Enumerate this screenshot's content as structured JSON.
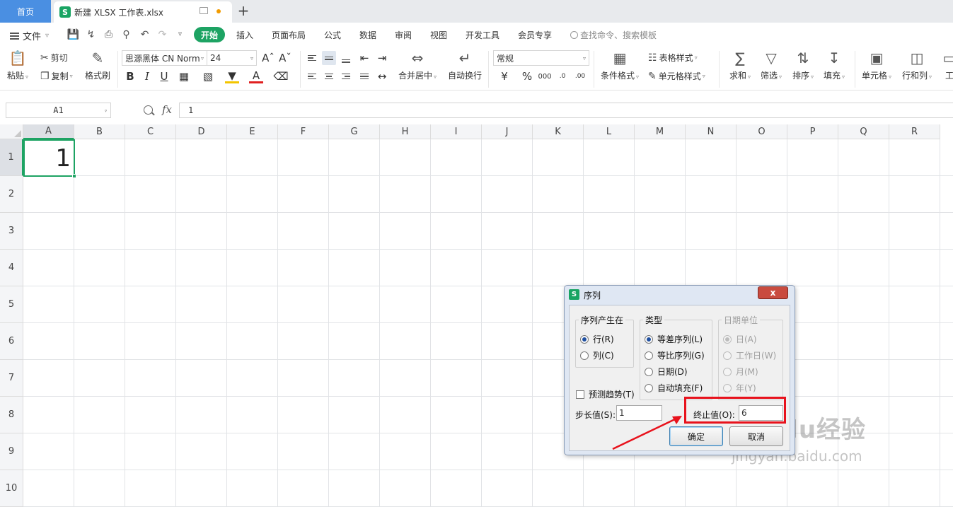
{
  "tabs": {
    "home": "首页",
    "doc_icon": "S",
    "doc_title": "新建 XLSX 工作表.xlsx",
    "add": "+"
  },
  "menu": {
    "file": "文件",
    "items": [
      "开始",
      "插入",
      "页面布局",
      "公式",
      "数据",
      "审阅",
      "视图",
      "开发工具",
      "会员专享"
    ],
    "search_placeholder": "查找命令、搜索模板"
  },
  "ribbon": {
    "paste": "粘贴",
    "cut": "剪切",
    "copy": "复制",
    "format_painter": "格式刷",
    "font_name": "思源黑体 CN Norm",
    "font_size": "24",
    "merge_center": "合并居中",
    "wrap_text": "自动换行",
    "number_format": "常规",
    "cond_format": "条件格式",
    "table_style": "表格样式",
    "cell_style": "单元格样式",
    "sum": "求和",
    "filter": "筛选",
    "sort": "排序",
    "fill": "填充",
    "cell": "单元格",
    "row_col": "行和列",
    "work": "工"
  },
  "formula_bar": {
    "name_box": "A1",
    "fx": "fx",
    "value": "1"
  },
  "sheet": {
    "columns": [
      "A",
      "B",
      "C",
      "D",
      "E",
      "F",
      "G",
      "H",
      "I",
      "J",
      "K",
      "L",
      "M",
      "N",
      "O",
      "P",
      "Q",
      "R"
    ],
    "rows": [
      "1",
      "2",
      "3",
      "4",
      "5",
      "6",
      "7",
      "8",
      "9",
      "10"
    ],
    "active_cell_value": "1"
  },
  "dialog": {
    "icon": "S",
    "title": "序列",
    "close": "x",
    "group_series_in": "序列产生在",
    "opt_rows": "行(R)",
    "opt_cols": "列(C)",
    "group_type": "类型",
    "opt_linear": "等差序列(L)",
    "opt_growth": "等比序列(G)",
    "opt_date": "日期(D)",
    "opt_autofill": "自动填充(F)",
    "group_date_unit": "日期单位",
    "opt_day": "日(A)",
    "opt_weekday": "工作日(W)",
    "opt_month": "月(M)",
    "opt_year": "年(Y)",
    "trend": "预测趋势(T)",
    "step_label": "步长值(S):",
    "step_value": "1",
    "stop_label": "终止值(O):",
    "stop_value": "6",
    "ok": "确定",
    "cancel": "取消"
  },
  "watermark": {
    "main": "Baidu经验",
    "sub": "jingyan.baidu.com"
  },
  "colors": {
    "accent": "#1da363",
    "home_tab": "#4a8fe2",
    "annotation": "#e8121c"
  }
}
